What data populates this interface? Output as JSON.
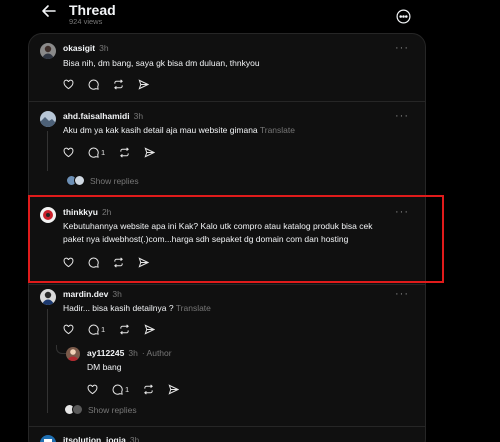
{
  "header": {
    "title": "Thread",
    "views": "924 views"
  },
  "posts": [
    {
      "username": "okasigit",
      "time": "3h",
      "text": "Bisa nih, dm bang, saya gk bisa dm duluan, thnkyou"
    },
    {
      "username": "ahd.faisalhamidi",
      "time": "3h",
      "text": "Aku dm ya kak kasih detail aja mau website gimana",
      "translate": "Translate",
      "reply_count": "1",
      "show_replies": "Show replies"
    },
    {
      "username": "thinkkyu",
      "time": "2h",
      "text_line1": "Kebutuhannya website apa ini Kak? Kalo utk compro atau katalog produk bisa cek",
      "text_line2": "paket nya idwebhost(.)com...harga sdh sepaket dg domain com dan hosting"
    },
    {
      "username": "mardin.dev",
      "time": "3h",
      "text": "Hadir... bisa kasih detailnya ?",
      "translate": "Translate",
      "reply_count": "1"
    },
    {
      "username": "ay112245",
      "time": "3h",
      "author_tag": "· Author",
      "text": "DM bang",
      "reply_count": "1",
      "show_replies": "Show replies"
    },
    {
      "username": "itsolution_jogja",
      "time": "3h"
    }
  ],
  "colors": {
    "background": "#000000",
    "card": "#101010",
    "highlight": "#e01b1b",
    "muted": "#777777"
  }
}
